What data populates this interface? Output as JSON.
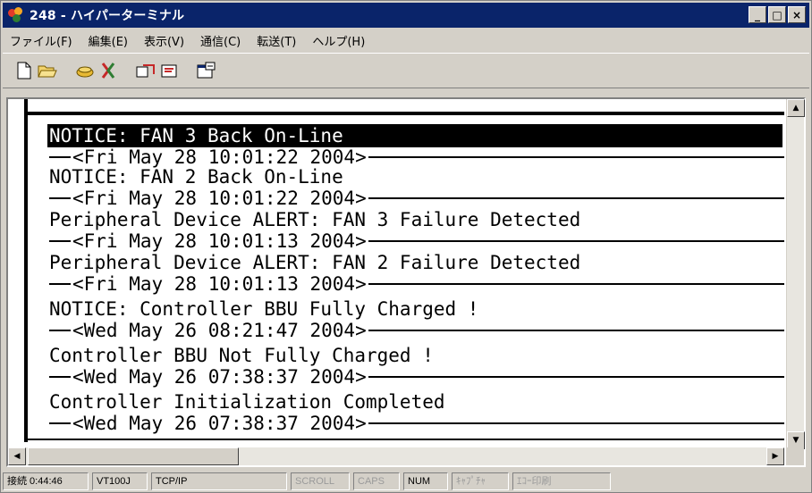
{
  "window": {
    "title": "248 - ハイパーターミナル",
    "controls": {
      "minimize": "_",
      "maximize": "□",
      "close": "×"
    }
  },
  "menu": [
    "ファイル(F)",
    "編集(E)",
    "表示(V)",
    "通信(C)",
    "転送(T)",
    "ヘルプ(H)"
  ],
  "toolbar": {
    "groups": [
      [
        "new-icon",
        "open-icon"
      ],
      [
        "connect-icon",
        "disconnect-icon"
      ],
      [
        "send-icon",
        "receive-icon"
      ],
      [
        "properties-icon"
      ]
    ]
  },
  "terminal": {
    "highlighted_line": "NOTICE: FAN 3 Back On-Line",
    "entries": [
      {
        "timestamp": "<Fri May 28 10:01:22 2004>",
        "message": "NOTICE: FAN 2 Back On-Line"
      },
      {
        "timestamp": "<Fri May 28 10:01:22 2004>",
        "message": "Peripheral Device ALERT: FAN 3 Failure Detected"
      },
      {
        "timestamp": "<Fri May 28 10:01:13 2004>",
        "message": "Peripheral Device ALERT: FAN 2 Failure Detected"
      },
      {
        "timestamp": "<Fri May 28 10:01:13 2004>",
        "message": "NOTICE: Controller BBU Fully Charged !"
      },
      {
        "timestamp": "<Wed May 26 08:21:47 2004>",
        "message": "Controller BBU Not Fully Charged !"
      },
      {
        "timestamp": "<Wed May 26 07:38:37 2004>",
        "message": "Controller Initialization Completed"
      },
      {
        "timestamp": "<Wed May 26 07:38:37 2004>",
        "message": ""
      }
    ]
  },
  "status": {
    "connection": "接続 0:44:46",
    "emulation": "VT100J",
    "protocol": "TCP/IP",
    "scroll": "SCROLL",
    "caps": "CAPS",
    "num": "NUM",
    "capture": "ｷｬﾌﾟﾁｬ",
    "echo": "ｴｺｰ印刷"
  },
  "colors": {
    "titlebar": "#0a246a",
    "chrome": "#d4d0c8",
    "terminal_bg": "#ffffff",
    "terminal_text": "#000000"
  }
}
